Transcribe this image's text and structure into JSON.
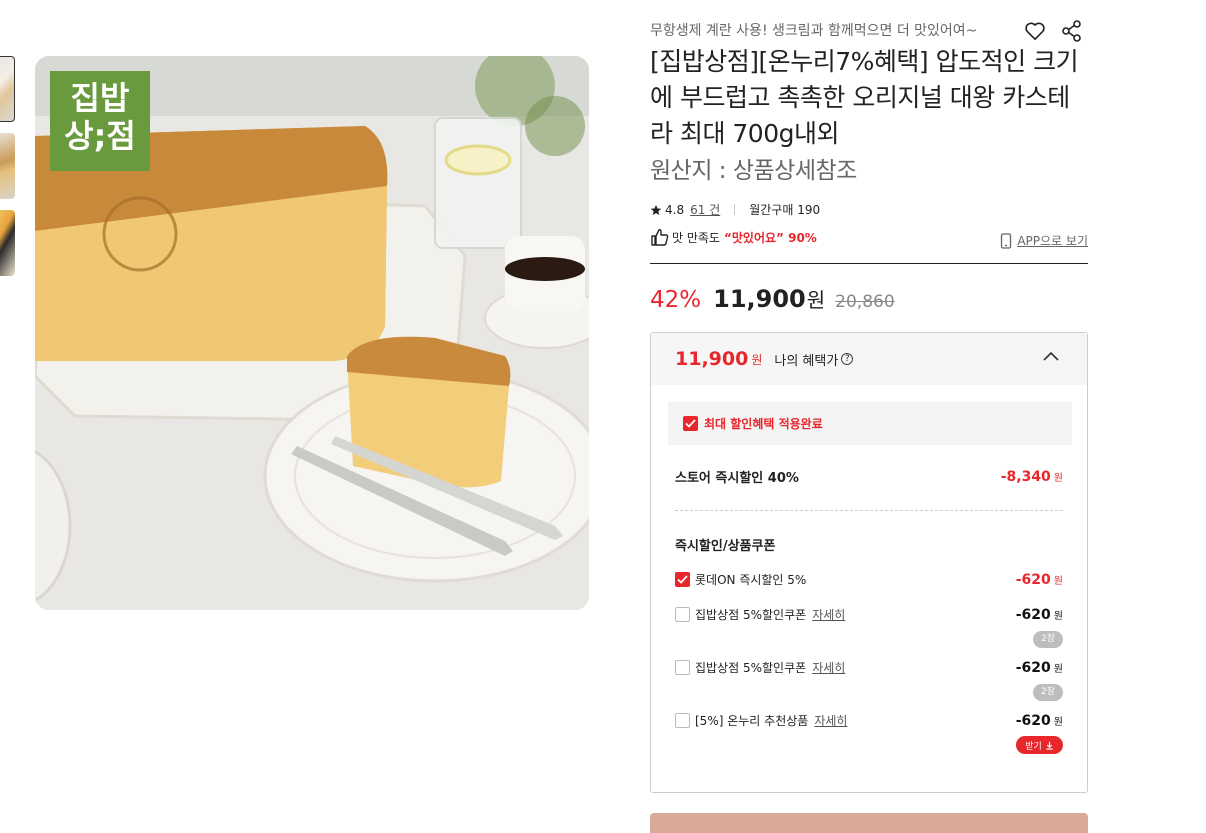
{
  "product": {
    "promo_text": "무항생제 계란 사용! 생크림과 함께먹으면 더 맛있어여~",
    "title": "[집밥상점][온누리7%혜택] 압도적인 크기에 부드럽고 촉촉한 오리지널 대왕 카스테라 최대 700g내외",
    "origin": "원산지 : 상품상세참조",
    "brand_badge_line1": "집밥",
    "brand_badge_line2": "상;점",
    "rating": "4.8",
    "review_count": "61 건",
    "monthly_purchase": "월간구매 190",
    "satisfaction_label": "맛 만족도",
    "satisfaction_value": "“맛있어요” 90%",
    "app_view_label": "APP으로 보기"
  },
  "price": {
    "discount_rate": "42%",
    "price": "11,900",
    "won": "원",
    "original": "20,860"
  },
  "benefit": {
    "price": "11,900",
    "won": "원",
    "label": "나의 혜택가",
    "help_icon": "?",
    "applied_label": "최대 할인혜택 적용완료",
    "store_discount_label": "스토어 즉시할인 40%",
    "store_discount_amount": "-8,340",
    "section_title": "즉시할인/상품쿠폰",
    "coupons": [
      {
        "label": "롯데ON 즉시할인 5%",
        "more": "",
        "amount": "-620",
        "checked": true
      },
      {
        "label": "집밥상점 5%할인쿠폰",
        "more": "자세히",
        "amount": "-620",
        "checked": false,
        "qty": "2장"
      },
      {
        "label": "집밥상점 5%할인쿠폰",
        "more": "자세히",
        "amount": "-620",
        "checked": false,
        "qty": "2장"
      },
      {
        "label": "[5%] 온누리 추천상품",
        "more": "자세히",
        "amount": "-620",
        "checked": false,
        "receive": "받기"
      }
    ]
  },
  "colors": {
    "accent": "#e8272d",
    "brand_green": "#6a9a3e"
  },
  "icons": [
    "heart-icon",
    "share-icon",
    "star-icon",
    "thumbs-up-icon",
    "mobile-icon",
    "chevron-up-icon",
    "check-icon",
    "download-icon"
  ]
}
